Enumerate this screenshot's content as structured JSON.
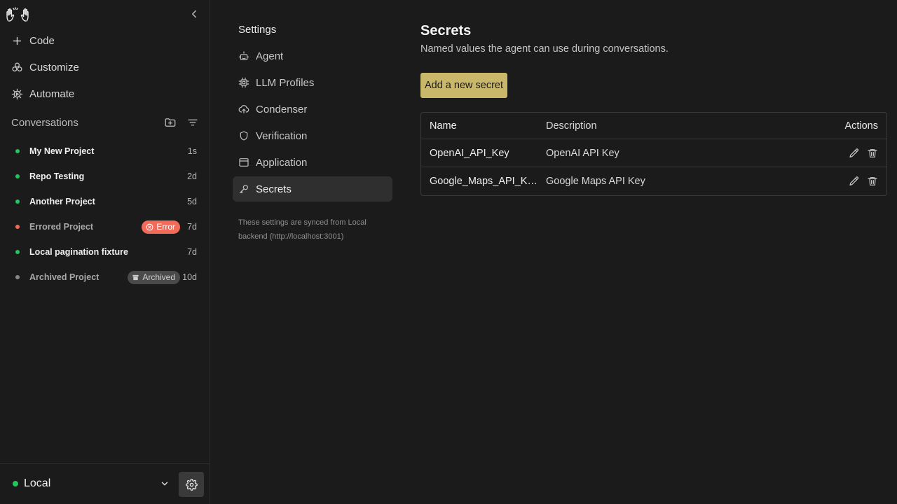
{
  "sidebar": {
    "nav": [
      {
        "label": "Code",
        "icon": "plus-icon"
      },
      {
        "label": "Customize",
        "icon": "puzzle-icon"
      },
      {
        "label": "Automate",
        "icon": "automate-icon"
      }
    ],
    "conversations_title": "Conversations",
    "conversations": [
      {
        "name": "My New Project",
        "time": "1s",
        "status": "green"
      },
      {
        "name": "Repo Testing",
        "time": "2d",
        "status": "green"
      },
      {
        "name": "Another Project",
        "time": "5d",
        "status": "green"
      },
      {
        "name": "Errored Project",
        "time": "7d",
        "status": "red",
        "badge": "Error"
      },
      {
        "name": "Local pagination fixture",
        "time": "7d",
        "status": "green"
      },
      {
        "name": "Archived Project",
        "time": "10d",
        "status": "gray",
        "badge": "Archived"
      }
    ],
    "backend_label": "Local"
  },
  "settings": {
    "title": "Settings",
    "items": [
      {
        "label": "Agent"
      },
      {
        "label": "LLM Profiles"
      },
      {
        "label": "Condenser"
      },
      {
        "label": "Verification"
      },
      {
        "label": "Application"
      },
      {
        "label": "Secrets"
      }
    ],
    "sync_note": "These settings are synced from Local backend (http://localhost:3001)"
  },
  "main": {
    "title": "Secrets",
    "subtitle": "Named values the agent can use during conversations.",
    "add_button": "Add a new secret",
    "table": {
      "headers": {
        "name": "Name",
        "description": "Description",
        "actions": "Actions"
      },
      "rows": [
        {
          "name": "OpenAI_API_Key",
          "description": "OpenAI API Key"
        },
        {
          "name": "Google_Maps_API_Key",
          "description": "Google Maps API Key"
        }
      ]
    }
  },
  "colors": {
    "accent": "#c9b76a",
    "online": "#22c55e",
    "error": "#f16b5a"
  }
}
